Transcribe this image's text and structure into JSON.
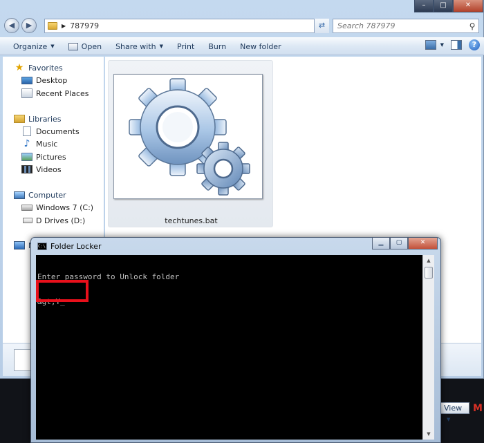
{
  "address": {
    "path": "787979"
  },
  "search": {
    "placeholder": "Search 787979"
  },
  "toolbar": {
    "organize": "Organize",
    "open": "Open",
    "share_with": "Share with",
    "print": "Print",
    "burn": "Burn",
    "new_folder": "New folder"
  },
  "nav": {
    "favorites": "Favorites",
    "desktop": "Desktop",
    "recent_places": "Recent Places",
    "libraries": "Libraries",
    "documents": "Documents",
    "music": "Music",
    "pictures": "Pictures",
    "videos": "Videos",
    "computer": "Computer",
    "drive_c": "Windows 7 (C:)",
    "drive_d": "D Drives (D:)",
    "network": "N"
  },
  "files": [
    {
      "name": "techtunes.bat"
    }
  ],
  "console": {
    "title": "Folder Locker",
    "prompt_line": "Enter password to Unlock folder",
    "input_line": "&gt;Y",
    "cursor": "_"
  },
  "taskbar": {
    "view_label": "View",
    "mail_glyph": "M"
  },
  "colors": {
    "highlight": "#e8101b",
    "console_bg": "#000000",
    "console_text": "#c0c0c0"
  }
}
